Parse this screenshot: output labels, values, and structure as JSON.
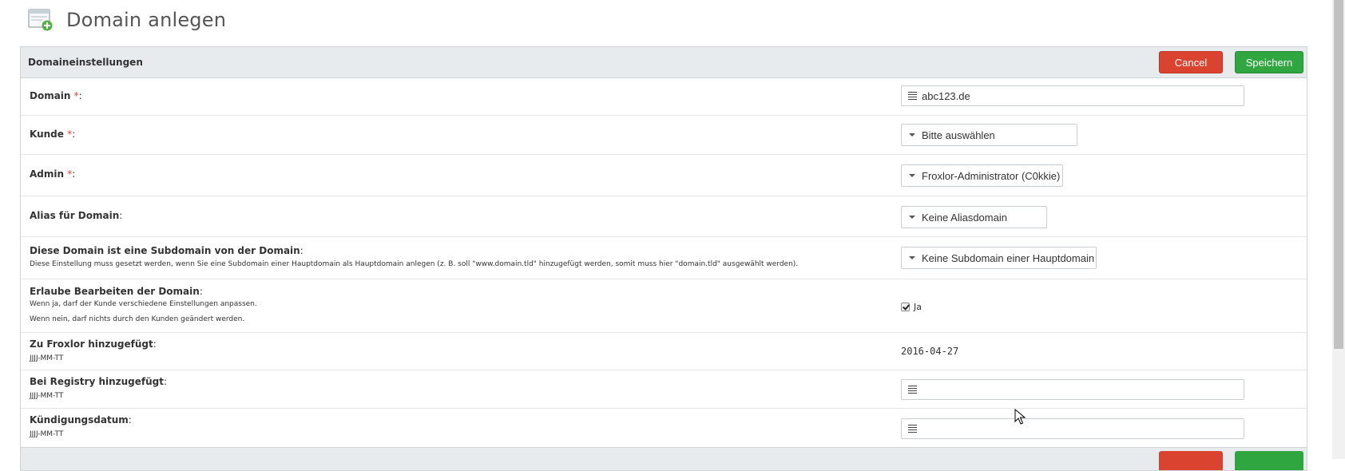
{
  "page": {
    "title": "Domain anlegen"
  },
  "panel": {
    "title": "Domaineinstellungen",
    "cancel_label": "Cancel",
    "save_label": "Speichern"
  },
  "fields": {
    "domain": {
      "label": "Domain",
      "required": "*",
      "colon": ":",
      "value": "abc123.de"
    },
    "kunde": {
      "label": "Kunde",
      "required": "*",
      "colon": ":",
      "value": "Bitte auswählen"
    },
    "admin": {
      "label": "Admin",
      "required": "*",
      "colon": ":",
      "value": "Froxlor-Administrator (C0kkie)"
    },
    "alias": {
      "label": "Alias für Domain",
      "colon": ":",
      "value": "Keine Aliasdomain"
    },
    "subdomain": {
      "label": "Diese Domain ist eine Subdomain von der Domain",
      "colon": ":",
      "desc": "Diese Einstellung muss gesetzt werden, wenn Sie eine Subdomain einer Hauptdomain als Hauptdomain anlegen (z. B. soll \"www.domain.tld\" hinzugefügt werden, somit muss hier \"domain.tld\" ausgewählt werden).",
      "value": "Keine Subdomain einer Hauptdomain"
    },
    "edit_allowed": {
      "label": "Erlaube Bearbeiten der Domain",
      "colon": ":",
      "desc1": "Wenn ja, darf der Kunde verschiedene Einstellungen anpassen.",
      "desc2": "Wenn nein, darf nichts durch den Kunden geändert werden.",
      "checked": true,
      "value_label": "Ja"
    },
    "added_froxlor": {
      "label": "Zu Froxlor hinzugefügt",
      "colon": ":",
      "format": "JJJJ-MM-TT",
      "value": "2016-04-27"
    },
    "added_registry": {
      "label": "Bei Registry hinzugefügt",
      "colon": ":",
      "format": "JJJJ-MM-TT",
      "value": ""
    },
    "termination": {
      "label": "Kündigungsdatum",
      "colon": ":",
      "format": "JJJJ-MM-TT",
      "value": ""
    }
  },
  "icons": {
    "page_icon": "window-add-icon",
    "text_input": "lines-icon",
    "select": "caret-down-icon"
  },
  "colors": {
    "cancel": "#d9432f",
    "save": "#2fa640",
    "required": "#d9432f"
  }
}
